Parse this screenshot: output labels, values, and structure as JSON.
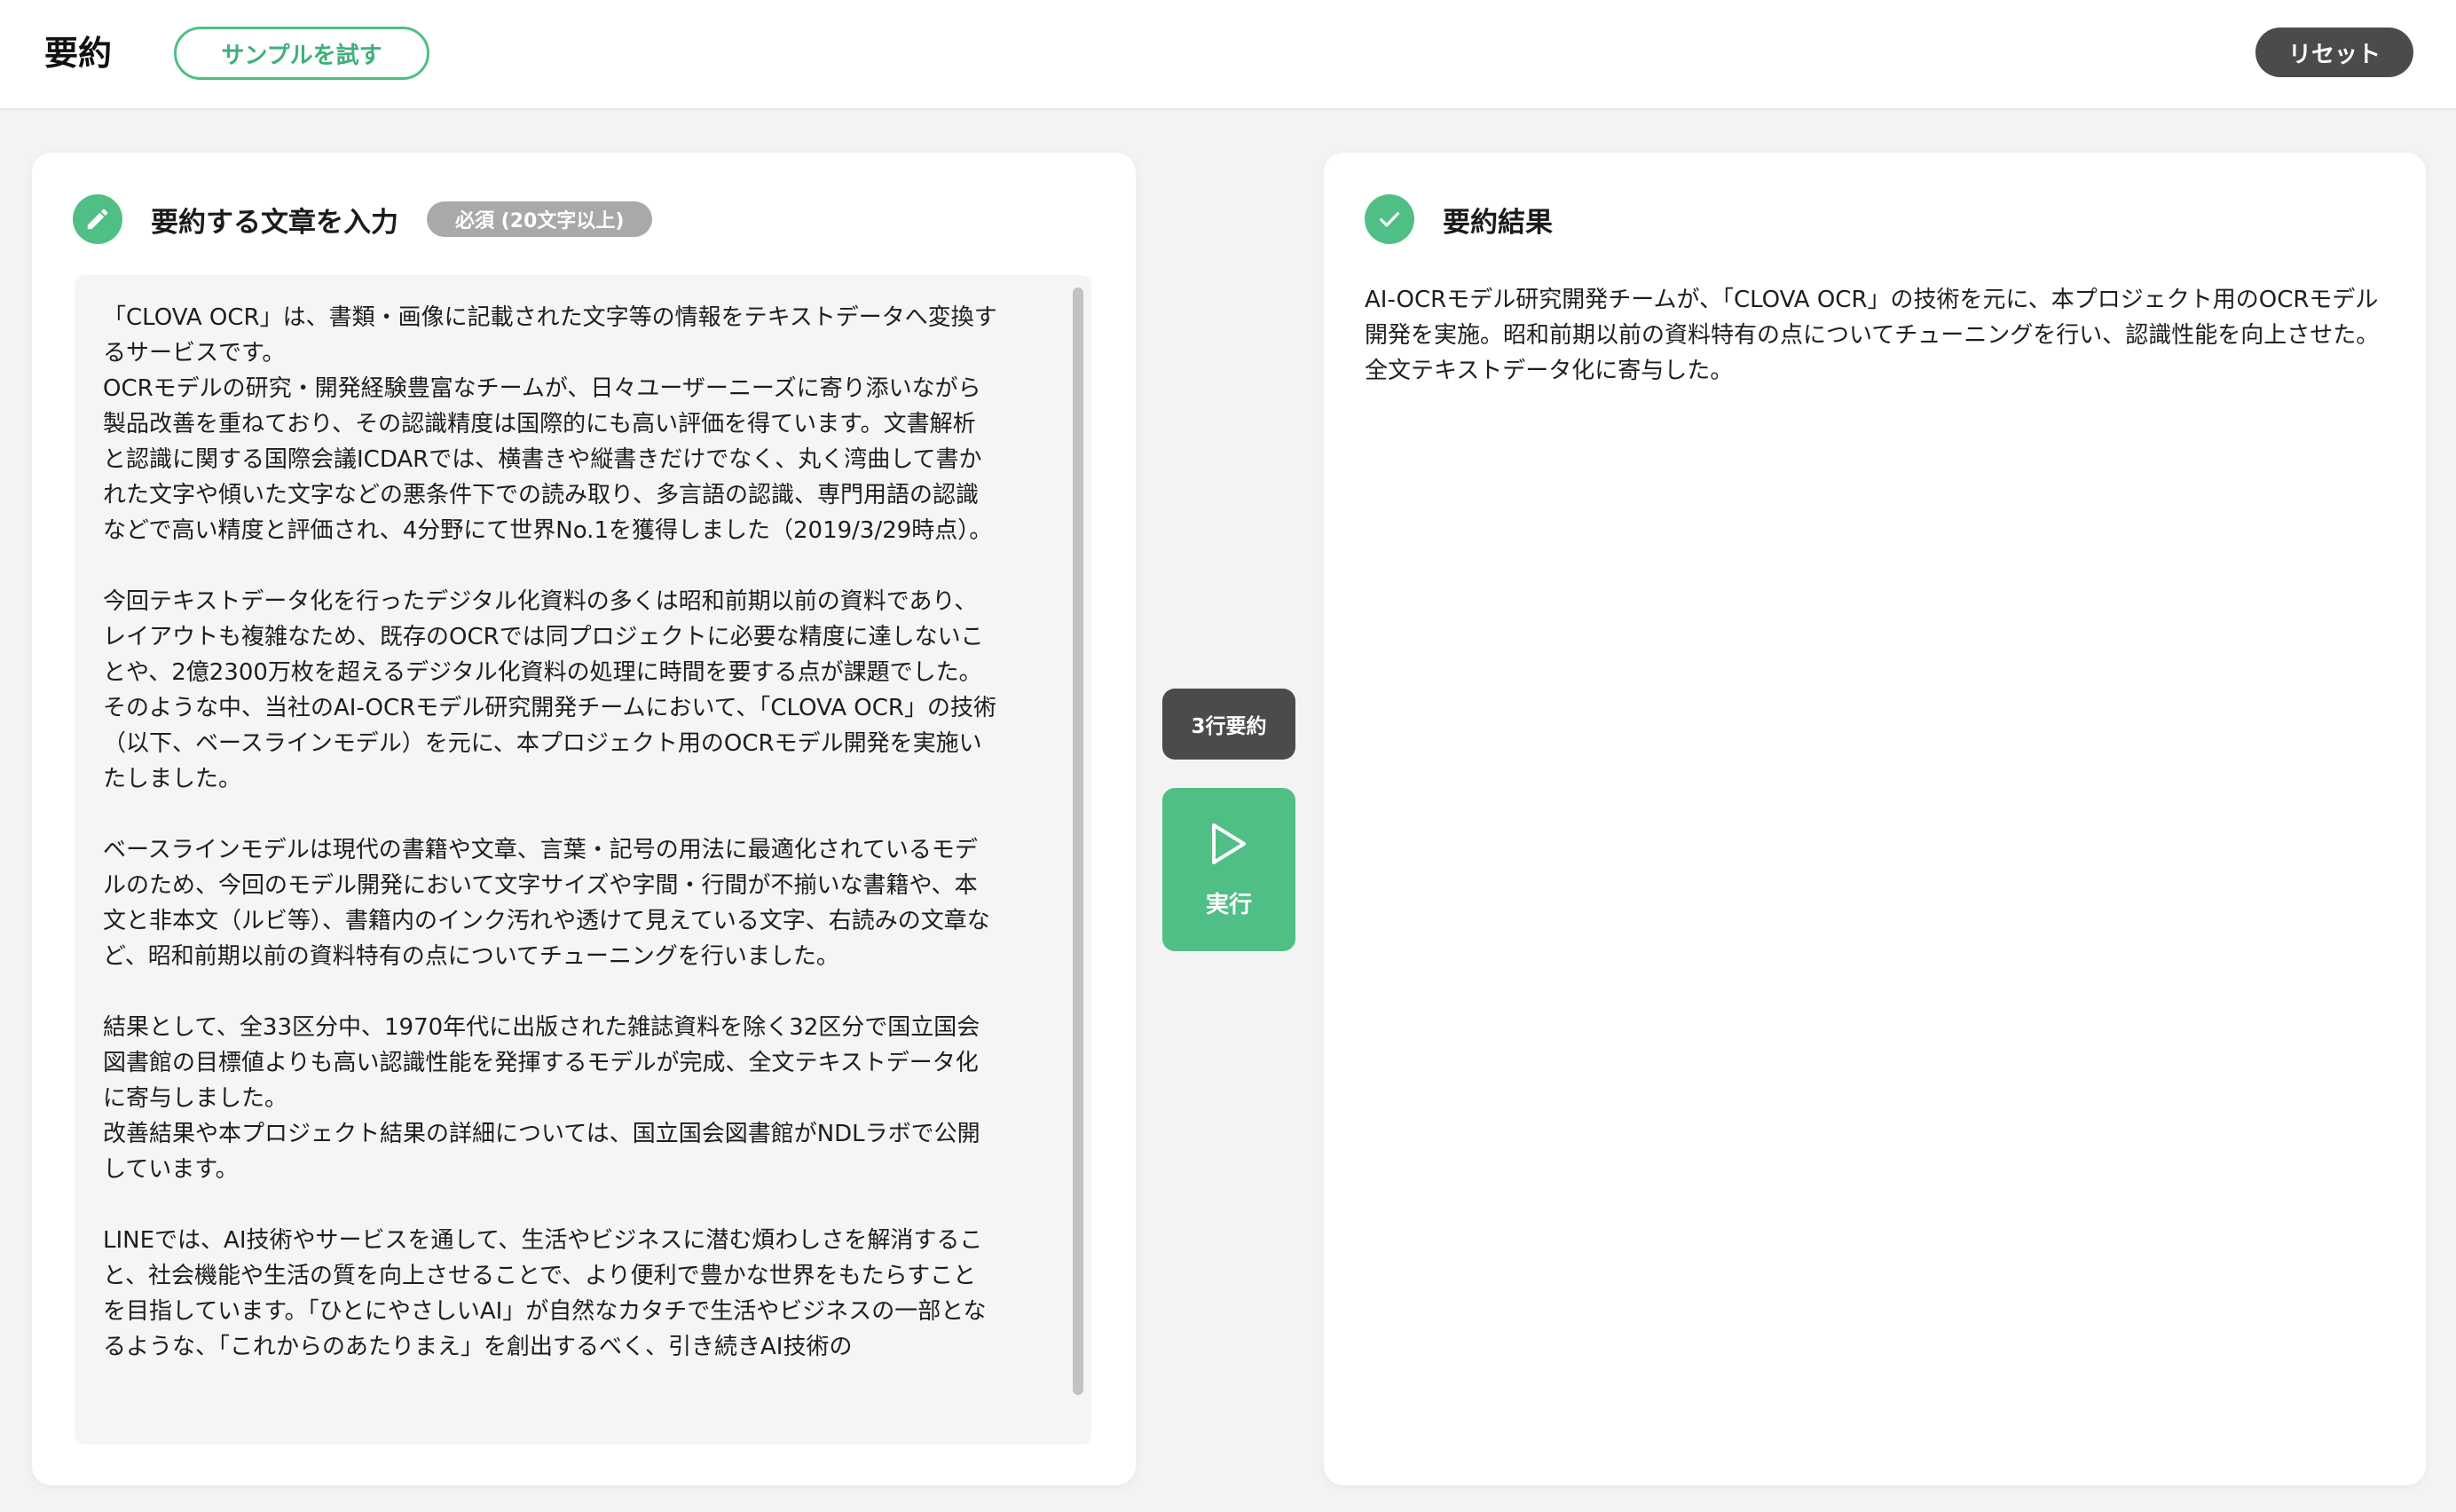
{
  "header": {
    "title": "要約",
    "sample_button": "サンプルを試す",
    "reset_button": "リセット"
  },
  "input_panel": {
    "title": "要約する文章を入力",
    "badge": "必須 (20文字以上)",
    "text": "「CLOVA OCR」は、書類・画像に記載された文字等の情報をテキストデータへ変換するサービスです。\nOCRモデルの研究・開発経験豊富なチームが、日々ユーザーニーズに寄り添いながら製品改善を重ねており、その認識精度は国際的にも高い評価を得ています。文書解析と認識に関する国際会議ICDARでは、横書きや縦書きだけでなく、丸く湾曲して書かれた文字や傾いた文字などの悪条件下での読み取り、多言語の認識、専門用語の認識などで高い精度と評価され、4分野にて世界No.1を獲得しました（2019/3/29時点）。\n\n今回テキストデータ化を行ったデジタル化資料の多くは昭和前期以前の資料であり、レイアウトも複雑なため、既存のOCRでは同プロジェクトに必要な精度に達しないことや、2億2300万枚を超えるデジタル化資料の処理に時間を要する点が課題でした。\nそのような中、当社のAI-OCRモデル研究開発チームにおいて、「CLOVA OCR」の技術（以下、ベースラインモデル）を元に、本プロジェクト用のOCRモデル開発を実施いたしました。\n\nベースラインモデルは現代の書籍や文章、言葉・記号の用法に最適化されているモデルのため、今回のモデル開発において文字サイズや字間・行間が不揃いな書籍や、本文と非本文（ルビ等）、書籍内のインク汚れや透けて見えている文字、右読みの文章など、昭和前期以前の資料特有の点についてチューニングを行いました。\n\n結果として、全33区分中、1970年代に出版された雑誌資料を除く32区分で国立国会図書館の目標値よりも高い認識性能を発揮するモデルが完成、全文テキストデータ化に寄与しました。\n改善結果や本プロジェクト結果の詳細については、国立国会図書館がNDLラボで公開しています。\n\nLINEでは、AI技術やサービスを通して、生活やビジネスに潜む煩わしさを解消すること、社会機能や生活の質を向上させることで、より便利で豊かな世界をもたらすことを目指しています。「ひとにやさしいAI」が自然なカタチで生活やビジネスの一部となるような、「これからのあたりまえ」を創出するべく、引き続きAI技術の"
  },
  "actions": {
    "summarize_button": "3行要約",
    "run_button": "実行"
  },
  "result_panel": {
    "title": "要約結果",
    "text": "AI-OCRモデル研究開発チームが、「CLOVA OCR」の技術を元に、本プロジェクト用のOCRモデル開発を実施。昭和前期以前の資料特有の点についてチューニングを行い、認識性能を向上させた。全文テキストデータ化に寄与した。"
  },
  "colors": {
    "accent_green": "#4fbf86",
    "dark_button": "#4b4b4b",
    "badge_gray": "#a9a9a9",
    "input_background": "#f5f5f5"
  }
}
